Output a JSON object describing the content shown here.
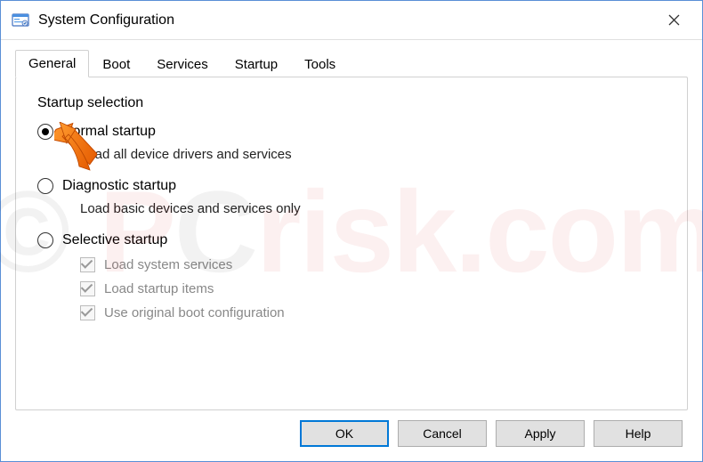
{
  "window": {
    "title": "System Configuration"
  },
  "tabs": {
    "general": "General",
    "boot": "Boot",
    "services": "Services",
    "startup": "Startup",
    "tools": "Tools"
  },
  "group": {
    "label": "Startup selection",
    "normal": {
      "label": "Normal startup",
      "desc": "Load all device drivers and services"
    },
    "diagnostic": {
      "label": "Diagnostic startup",
      "desc": "Load basic devices and services only"
    },
    "selective": {
      "label": "Selective startup",
      "checks": {
        "system_services": "Load system services",
        "startup_items": "Load startup items",
        "original_boot": "Use original boot configuration"
      }
    }
  },
  "buttons": {
    "ok": "OK",
    "cancel": "Cancel",
    "apply": "Apply",
    "help": "Help"
  },
  "watermark": {
    "prefix": "© ",
    "p": "P",
    "c": "C",
    "suffix": "risk.com"
  }
}
